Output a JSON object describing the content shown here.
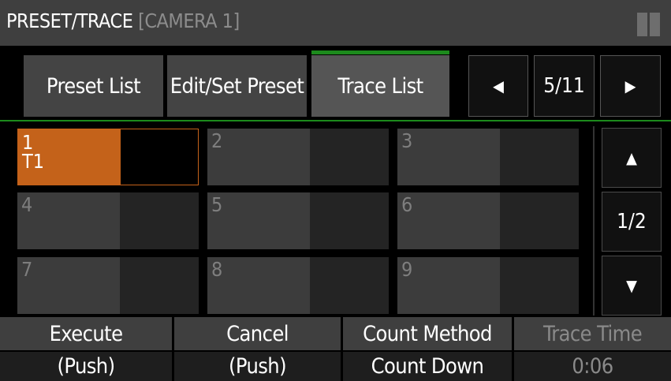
{
  "header": {
    "title": "PRESET/TRACE",
    "camera": "[CAMERA 1]"
  },
  "tabs": [
    {
      "label": "Preset List",
      "active": false
    },
    {
      "label": "Edit/Set Preset",
      "active": false
    },
    {
      "label": "Trace List",
      "active": true
    }
  ],
  "pager": {
    "prev": "◀",
    "page": "5/11",
    "next": "▶"
  },
  "grid": {
    "cells": [
      {
        "label": "1\nT1",
        "selected": true
      },
      {
        "label": "2",
        "selected": false
      },
      {
        "label": "3",
        "selected": false
      },
      {
        "label": "4",
        "selected": false
      },
      {
        "label": "5",
        "selected": false
      },
      {
        "label": "6",
        "selected": false
      },
      {
        "label": "7",
        "selected": false
      },
      {
        "label": "8",
        "selected": false
      },
      {
        "label": "9",
        "selected": false
      }
    ]
  },
  "scroll": {
    "up": "▲",
    "page": "1/2",
    "down": "▼"
  },
  "footer": {
    "execute": {
      "label": "Execute",
      "value": "(Push)"
    },
    "cancel": {
      "label": "Cancel",
      "value": "(Push)"
    },
    "count_method": {
      "label": "Count Method",
      "value": "Count Down"
    },
    "trace_time": {
      "label": "Trace Time",
      "value": "0:06"
    }
  },
  "colors": {
    "accent_green": "#1c8a1c",
    "selected_orange": "#c4621a"
  }
}
